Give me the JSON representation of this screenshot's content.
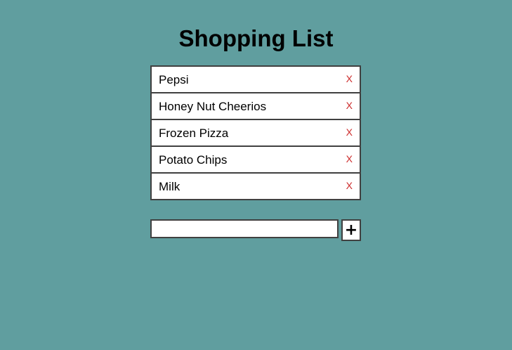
{
  "page": {
    "title": "Shopping List"
  },
  "list": {
    "items": [
      {
        "label": "Pepsi",
        "remove": "X"
      },
      {
        "label": "Honey Nut Cheerios",
        "remove": "X"
      },
      {
        "label": "Frozen Pizza",
        "remove": "X"
      },
      {
        "label": "Potato Chips",
        "remove": "X"
      },
      {
        "label": "Milk",
        "remove": "X"
      }
    ]
  },
  "form": {
    "input_value": "",
    "add_label": "+"
  },
  "colors": {
    "background": "#609e9f",
    "remove": "#cc2a2a",
    "border": "#404040"
  }
}
